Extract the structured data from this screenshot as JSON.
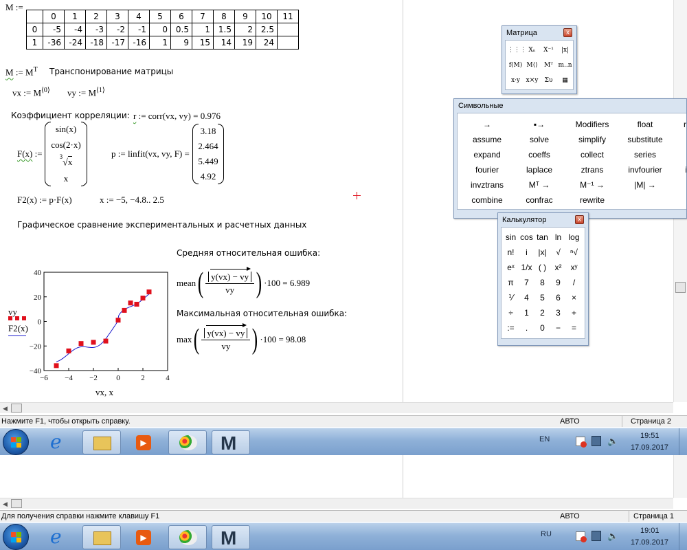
{
  "worksheet": {
    "matrix_def": "M :=",
    "matrix": {
      "col_headers": [
        "",
        "0",
        "1",
        "2",
        "3",
        "4",
        "5",
        "6",
        "7",
        "8",
        "9",
        "10",
        "11"
      ],
      "rows": [
        [
          "0",
          "-5",
          "-4",
          "-3",
          "-2",
          "-1",
          "0",
          "0.5",
          "1",
          "1.5",
          "2",
          "2.5",
          ""
        ],
        [
          "1",
          "-36",
          "-24",
          "-18",
          "-17",
          "-16",
          "1",
          "9",
          "15",
          "14",
          "19",
          "24",
          ""
        ]
      ]
    },
    "transpose_lhs": "M",
    "transpose_rhs": "M",
    "transpose_sup": "T",
    "transpose_comment": "Транспонирование матрицы",
    "vx_def": "vx := M",
    "vx_sup": "⟨0⟩",
    "vy_def": "vy := M",
    "vy_sup": "⟨1⟩",
    "corr_label": "Коэффициент корреляции:",
    "corr_lhs": "r",
    "corr_expr": ":= corr(vx, vy) = 0.976",
    "F_lhs": "F(x)",
    "F_assign": ":=",
    "F_vector": [
      "sin(x)",
      "cos(2·x)",
      "x",
      "x"
    ],
    "F_root_index": "3",
    "p_expr": "p := linfit(vx, vy, F) =",
    "p_vector": [
      "3.18",
      "2.464",
      "5.449",
      "4.92"
    ],
    "F2_expr": "F2(x) := p·F(x)",
    "x_range": "x := −5, −4.8.. 2.5",
    "graph_title": "Графическое сравнение экспериментальных и расчетных данных",
    "mean_label": "Средняя относительная ошибка:",
    "mean_fn": "mean",
    "mean_num": "y(vx) − vy",
    "mean_den": "vy",
    "mean_result": "·100 = 6.989",
    "max_label": "Максимальная относительная ошибка:",
    "max_fn": "max",
    "max_num": "y(vx) − vy",
    "max_den": "vy",
    "max_result": "·100 = 98.08"
  },
  "chart_data": {
    "type": "scatter",
    "title": "",
    "xlabel": "vx, x",
    "ylabel_series": [
      "vy",
      "F2(x)"
    ],
    "xlim": [
      -6,
      4
    ],
    "ylim": [
      -40,
      40
    ],
    "x_ticks": [
      "−6",
      "−4",
      "−2",
      "0",
      "2",
      "4"
    ],
    "y_ticks": [
      "40",
      "20",
      "0",
      "−20",
      "−40"
    ],
    "series": [
      {
        "name": "vy",
        "style": "red-square-points",
        "color": "#e0101c",
        "x": [
          -5,
          -4,
          -3,
          -2,
          -1,
          0,
          0.5,
          1,
          1.5,
          2,
          2.5
        ],
        "y": [
          -36,
          -24,
          -18,
          -17,
          -16,
          1,
          9,
          15,
          14,
          19,
          24
        ]
      },
      {
        "name": "F2(x)",
        "style": "blue-line",
        "color": "#1a1acc",
        "function": "3.18·sin(x) + 2.464·cos(2x) + 5.449·cbrt(x) + 4.92·x",
        "x_range": [
          -5,
          2.5
        ]
      }
    ]
  },
  "matrix_toolbar": {
    "title": "Матрица",
    "close": "x",
    "icons": [
      "matrix-icon",
      "subscript-icon",
      "inverse-icon",
      "determinant-icon",
      "vectorize-icon",
      "column-icon",
      "transpose-icon",
      "range-icon",
      "dot-product-icon",
      "cross-product-icon",
      "sum-icon",
      "picture-icon"
    ],
    "labels": [
      "⋮⋮⋮",
      "Xₙ",
      "X⁻¹",
      "|x|",
      "f(M)",
      "M⟨⟩",
      "Mᵀ",
      "m..n",
      "x·y",
      "x×y",
      "Συ",
      "▦"
    ]
  },
  "symbolic_toolbar": {
    "title": "Символьные",
    "items": [
      "→",
      "▪→",
      "Modifiers",
      "float",
      "rect",
      "assume",
      "solve",
      "simplify",
      "substitute",
      "p",
      "expand",
      "coeffs",
      "collect",
      "series",
      "p",
      "fourier",
      "laplace",
      "ztrans",
      "invfourier",
      "inv",
      "invztrans",
      "Mᵀ →",
      "M⁻¹ →",
      "|M| →",
      "e",
      "combine",
      "confrac",
      "rewrite",
      "",
      ""
    ]
  },
  "calculator_toolbar": {
    "title": "Калькулятор",
    "close": "x",
    "items": [
      "sin",
      "cos",
      "tan",
      "ln",
      "log",
      "n!",
      "i",
      "|x|",
      "√",
      "ⁿ√",
      "eˣ",
      "1/x",
      "( )",
      "x²",
      "xʸ",
      "π",
      "7",
      "8",
      "9",
      "/",
      "⅟",
      "4",
      "5",
      "6",
      "×",
      "÷",
      "1",
      "2",
      "3",
      "+",
      ":=",
      ".",
      "0",
      "−",
      "="
    ]
  },
  "status_top": {
    "help": "Нажмите F1, чтобы открыть справку.",
    "mode": "АВТО",
    "page": "Страница 2"
  },
  "status_bottom": {
    "help": "Для получения справки нажмите клавишу F1",
    "mode": "АВТО",
    "page": "Страница 1"
  },
  "taskbar_top": {
    "lang": "EN",
    "time": "19:51",
    "date": "17.09.2017"
  },
  "taskbar_bottom": {
    "lang": "RU",
    "time": "19:01",
    "date": "17.09.2017"
  }
}
